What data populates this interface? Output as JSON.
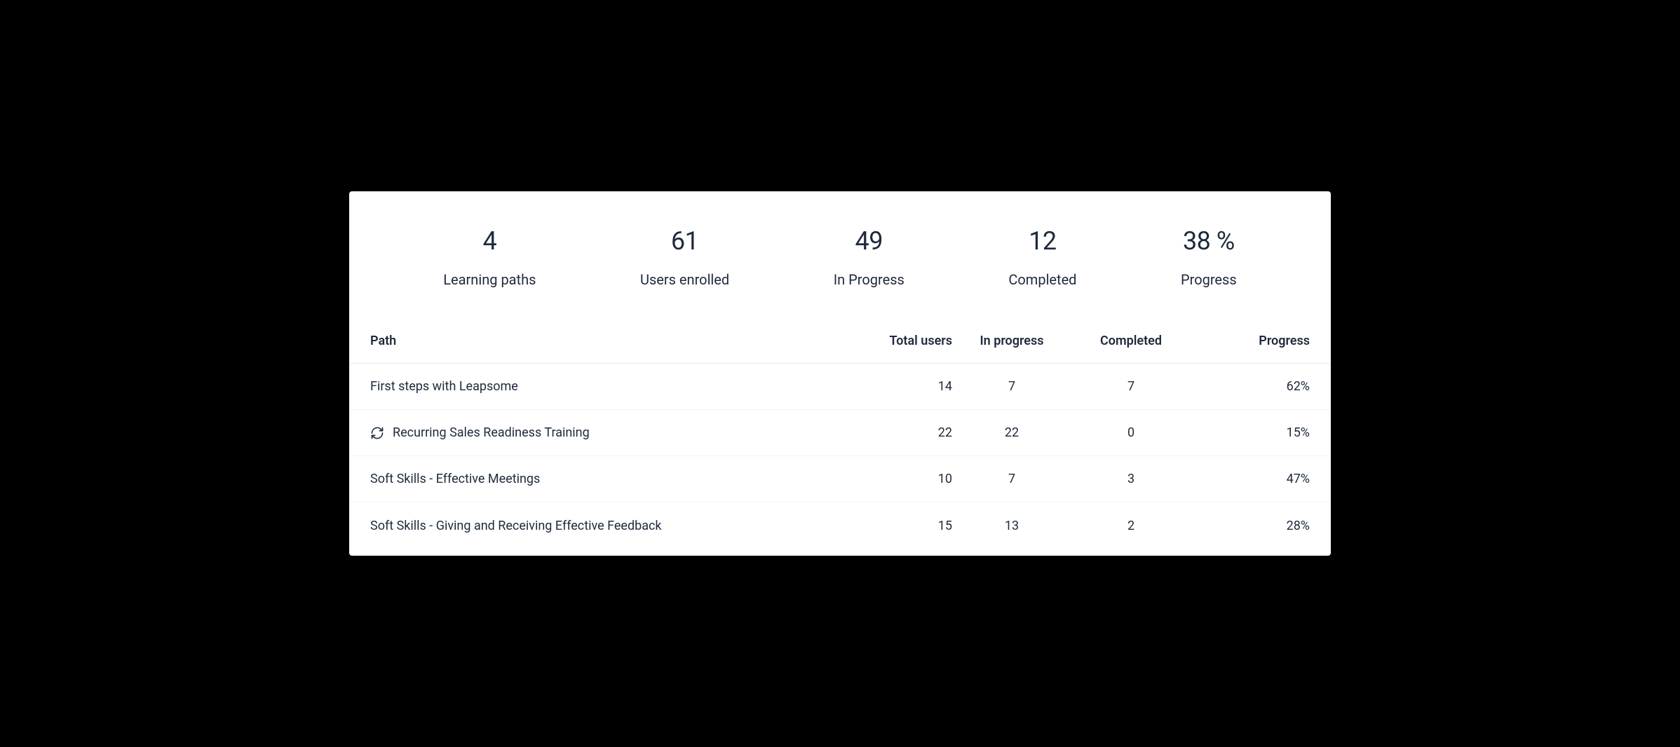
{
  "stats": [
    {
      "value": "4",
      "label": "Learning paths"
    },
    {
      "value": "61",
      "label": "Users enrolled"
    },
    {
      "value": "49",
      "label": "In Progress"
    },
    {
      "value": "12",
      "label": "Completed"
    },
    {
      "value": "38 %",
      "label": "Progress"
    }
  ],
  "table": {
    "columns": {
      "path": "Path",
      "total_users": "Total users",
      "in_progress": "In progress",
      "completed": "Completed",
      "progress": "Progress"
    },
    "rows": [
      {
        "recurring": false,
        "path": "First steps with Leapsome",
        "total_users": "14",
        "in_progress": "7",
        "completed": "7",
        "progress": "62%"
      },
      {
        "recurring": true,
        "path": "Recurring Sales Readiness Training",
        "total_users": "22",
        "in_progress": "22",
        "completed": "0",
        "progress": "15%"
      },
      {
        "recurring": false,
        "path": "Soft Skills - Effective Meetings",
        "total_users": "10",
        "in_progress": "7",
        "completed": "3",
        "progress": "47%"
      },
      {
        "recurring": false,
        "path": "Soft Skills - Giving and Receiving Effective Feedback",
        "total_users": "15",
        "in_progress": "13",
        "completed": "2",
        "progress": "28%"
      }
    ]
  }
}
